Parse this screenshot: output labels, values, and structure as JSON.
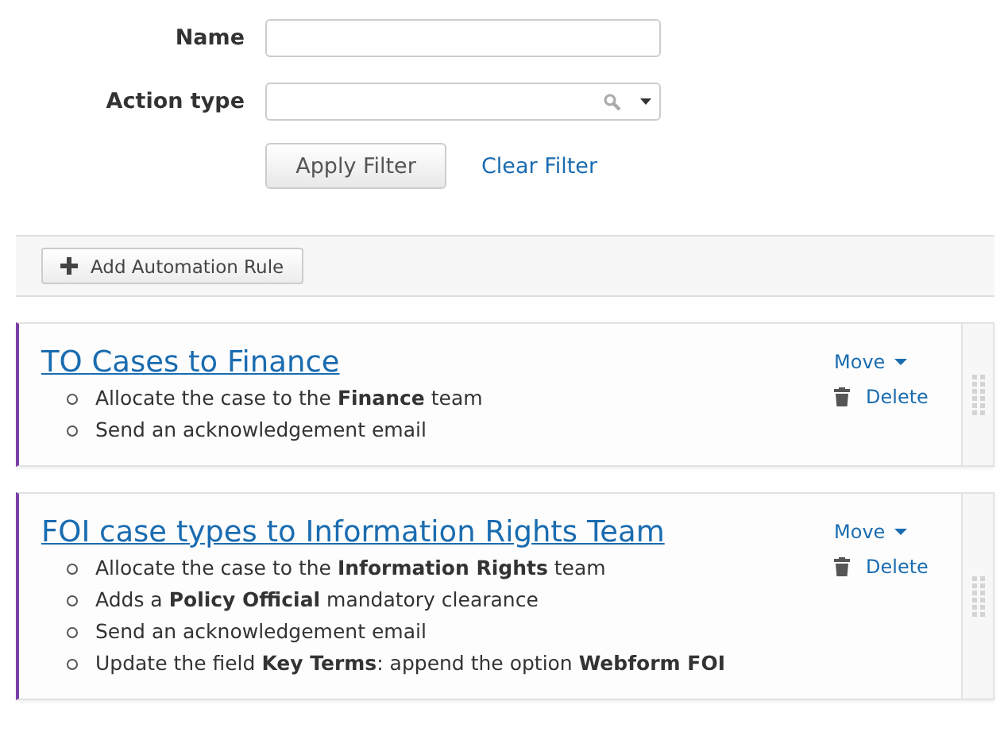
{
  "filter": {
    "name_label": "Name",
    "action_type_label": "Action type",
    "apply_button": "Apply Filter",
    "clear_link": "Clear Filter"
  },
  "toolbar": {
    "add_button": "Add Automation Rule"
  },
  "rules": [
    {
      "title": "TO Cases to Finance",
      "move": "Move",
      "delete": "Delete",
      "actions": [
        "Allocate the case to the **Finance** team",
        "Send an acknowledgement email"
      ]
    },
    {
      "title": "FOI case types to Information Rights Team",
      "move": "Move",
      "delete": "Delete",
      "actions": [
        "Allocate the case to the **Information Rights** team",
        "Adds a **Policy Official** mandatory clearance",
        "Send an acknowledgement email",
        "Update the field **Key Terms**: append the option **Webform FOI**"
      ]
    }
  ]
}
